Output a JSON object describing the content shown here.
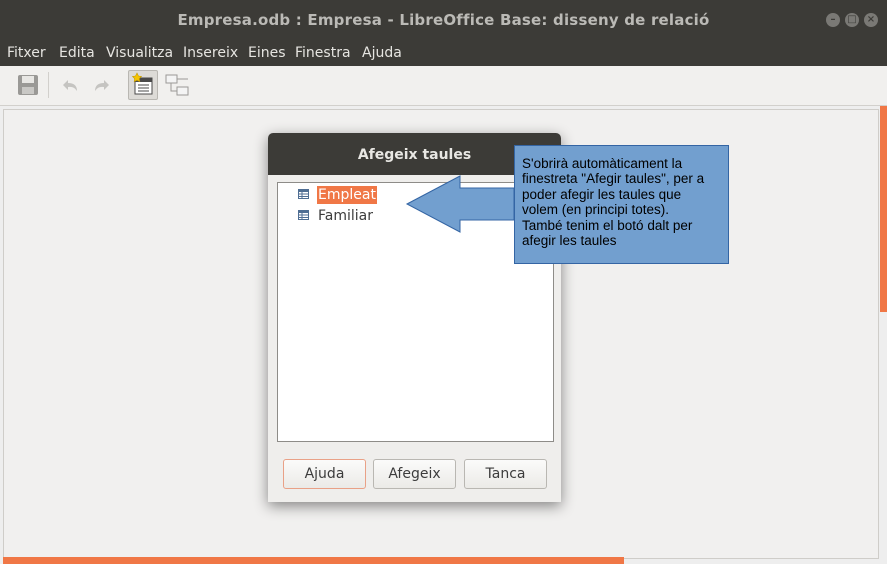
{
  "window": {
    "title": "Empresa.odb : Empresa - LibreOffice Base: disseny de relació",
    "controls": [
      "minimize-icon",
      "maximize-icon",
      "close-icon"
    ]
  },
  "menubar": {
    "items": [
      "Fitxer",
      "Edita",
      "Visualitza",
      "Insereix",
      "Eines",
      "Finestra",
      "Ajuda"
    ]
  },
  "toolbar": {
    "icons": [
      "save-icon",
      "undo-icon",
      "redo-icon",
      "add-tables-icon",
      "new-relation-icon"
    ]
  },
  "dialog": {
    "title": "Afegeix taules",
    "tables": [
      {
        "name": "Empleat",
        "selected": true
      },
      {
        "name": "Familiar",
        "selected": false
      }
    ],
    "buttons": {
      "help": "Ajuda",
      "add": "Afegeix",
      "close": "Tanca"
    }
  },
  "callout": {
    "text": "S'obrirà automàticament la\nfinestreta \"Afegir taules\", per a\npoder afegir les taules que\nvolem (en principi totes).\nTambé tenim el botó dalt per\nafegir les taules"
  },
  "colors": {
    "accent": "#f07746",
    "titlebar": "#3c3b37",
    "callout_fill": "#729fcf",
    "callout_border": "#3465a4"
  }
}
